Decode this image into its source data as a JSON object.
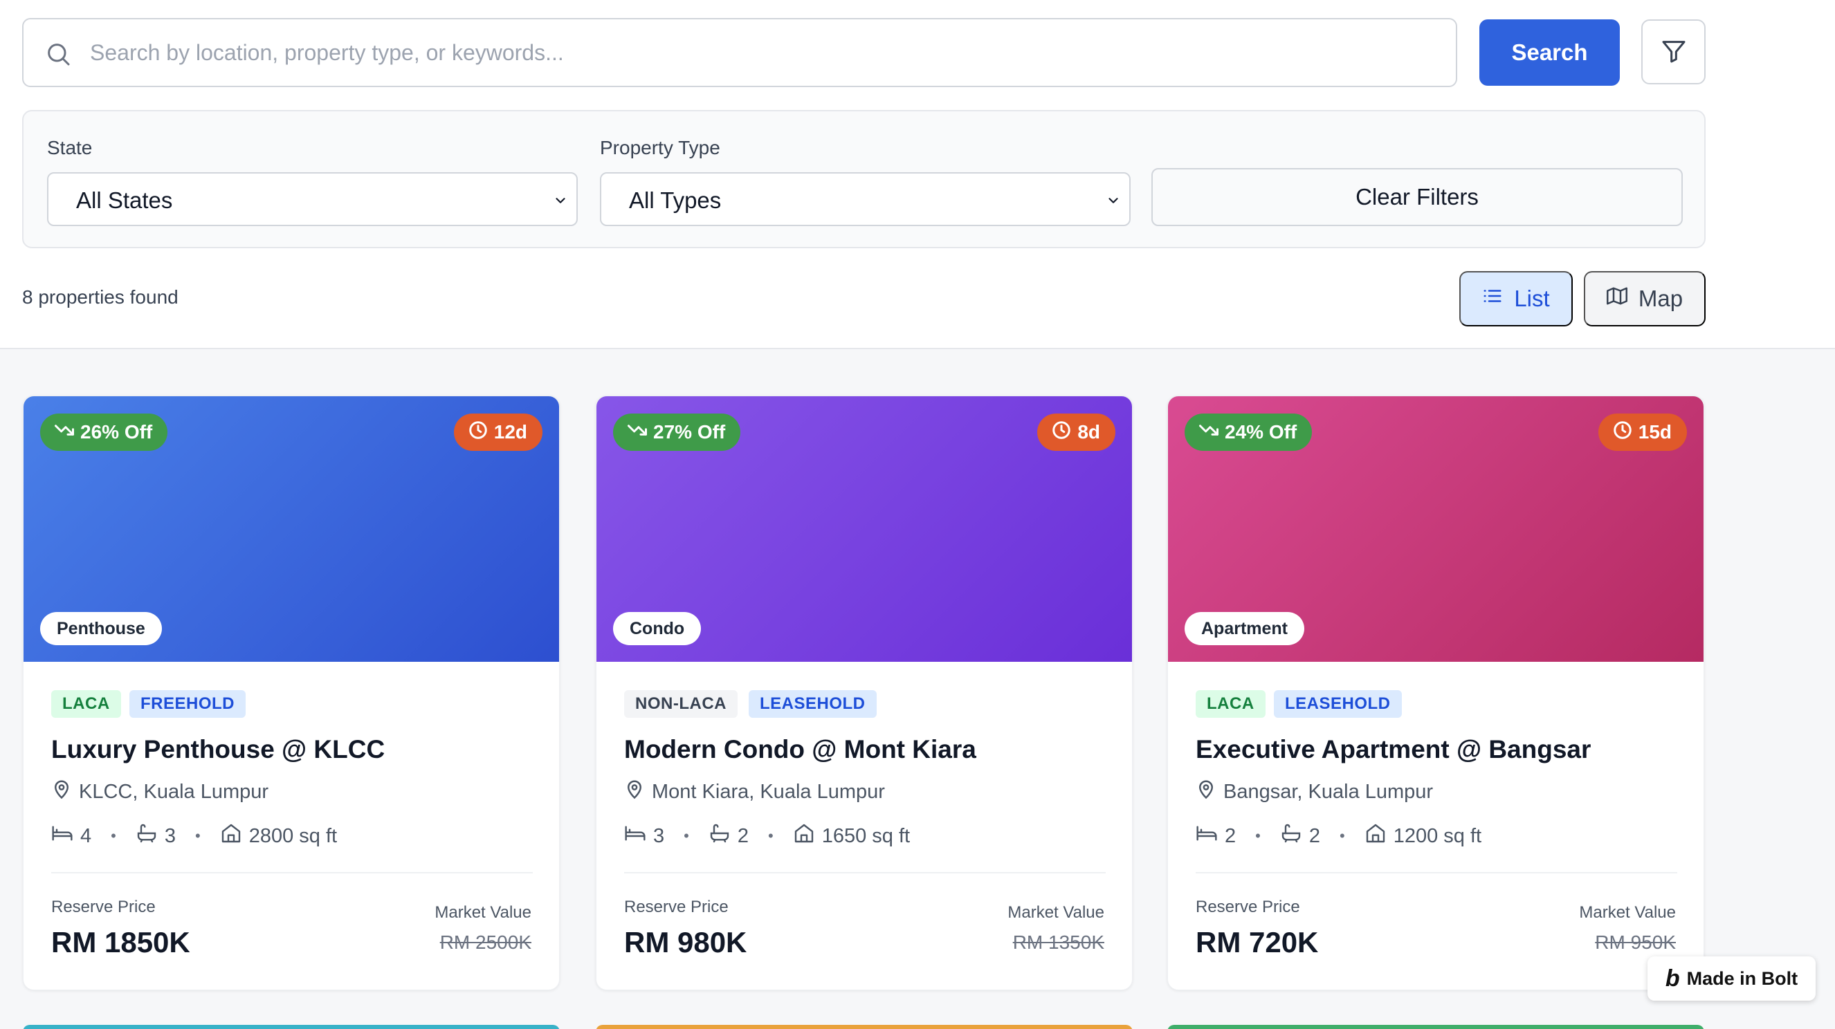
{
  "search": {
    "placeholder": "Search by location, property type, or keywords...",
    "button_label": "Search"
  },
  "filters": {
    "state_label": "State",
    "state_value": "All States",
    "type_label": "Property Type",
    "type_value": "All Types",
    "clear_label": "Clear Filters"
  },
  "results": {
    "count_text": "8 properties found",
    "view_list_label": "List",
    "view_map_label": "Map",
    "active_view": "List"
  },
  "properties": [
    {
      "discount": "26% Off",
      "days_left": "12d",
      "type": "Penthouse",
      "laca": "LACA",
      "tenure": "FREEHOLD",
      "title": "Luxury Penthouse @ KLCC",
      "location": "KLCC, Kuala Lumpur",
      "beds": "4",
      "baths": "3",
      "area": "2800 sq ft",
      "reserve_label": "Reserve Price",
      "reserve_price": "RM 1850K",
      "market_label": "Market Value",
      "market_value": "RM 2500K",
      "gradient": [
        "#4a80e8",
        "#2d4fd0"
      ]
    },
    {
      "discount": "27% Off",
      "days_left": "8d",
      "type": "Condo",
      "laca": "NON-LACA",
      "tenure": "LEASEHOLD",
      "title": "Modern Condo @ Mont Kiara",
      "location": "Mont Kiara, Kuala Lumpur",
      "beds": "3",
      "baths": "2",
      "area": "1650 sq ft",
      "reserve_label": "Reserve Price",
      "reserve_price": "RM 980K",
      "market_label": "Market Value",
      "market_value": "RM 1350K",
      "gradient": [
        "#8756e8",
        "#6a2fd8"
      ]
    },
    {
      "discount": "24% Off",
      "days_left": "15d",
      "type": "Apartment",
      "laca": "LACA",
      "tenure": "LEASEHOLD",
      "title": "Executive Apartment @ Bangsar",
      "location": "Bangsar, Kuala Lumpur",
      "beds": "2",
      "baths": "2",
      "area": "1200 sq ft",
      "reserve_label": "Reserve Price",
      "reserve_price": "RM 720K",
      "market_label": "Market Value",
      "market_value": "RM 950K",
      "gradient": [
        "#d94b92",
        "#b52a62"
      ]
    }
  ],
  "peek_colors": [
    "#38b2c8",
    "#e9a23b",
    "#3fae6a"
  ],
  "badge": {
    "label": "Made in Bolt"
  },
  "colors": {
    "primary": "#2f62dd",
    "discount": "#3f9b49",
    "countdown": "#e0592a"
  }
}
